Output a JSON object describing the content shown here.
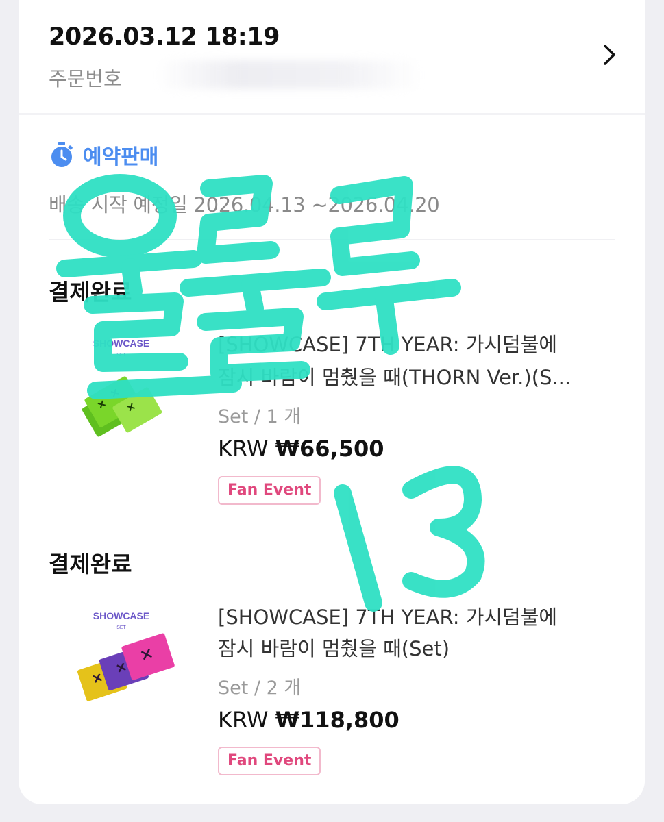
{
  "order": {
    "datetime": "2026.03.12 18:19",
    "number_label": "주문번호"
  },
  "presale": {
    "label": "예약판매",
    "ship_date": "배송 시작 예정일 2026.04.13 ~2026.04.20"
  },
  "items": [
    {
      "status": "결제완료",
      "thumb_title": "SHOWCASE",
      "thumb_sub": "SET",
      "name_line1": "[SHOWCASE] 7TH YEAR: 가시덤불에",
      "name_line2": "잠시 바람이 멈췄을 때(THORN Ver.)(S...",
      "option": "Set / 1 개",
      "currency": "KRW",
      "price": "₩66,500",
      "badge": "Fan Event",
      "colors": [
        "#7ad62a",
        "#5fbf1f",
        "#9be34a"
      ]
    },
    {
      "status": "결제완료",
      "thumb_title": "SHOWCASE",
      "thumb_sub": "SET",
      "name_line1": "[SHOWCASE] 7TH YEAR: 가시덤불에",
      "name_line2": "잠시 바람이 멈췄을 때(Set)",
      "option": "Set / 2 개",
      "currency": "KRW",
      "price": "₩118,800",
      "badge": "Fan Event",
      "colors": [
        "#e5c21a",
        "#6a3fb8",
        "#ea3fa6"
      ]
    }
  ],
  "overlay": {
    "handwriting": "울룰루 13",
    "color": "#2fe0c4"
  },
  "theme": {
    "accent": "#4c8df0",
    "badge": "#e0487d"
  }
}
